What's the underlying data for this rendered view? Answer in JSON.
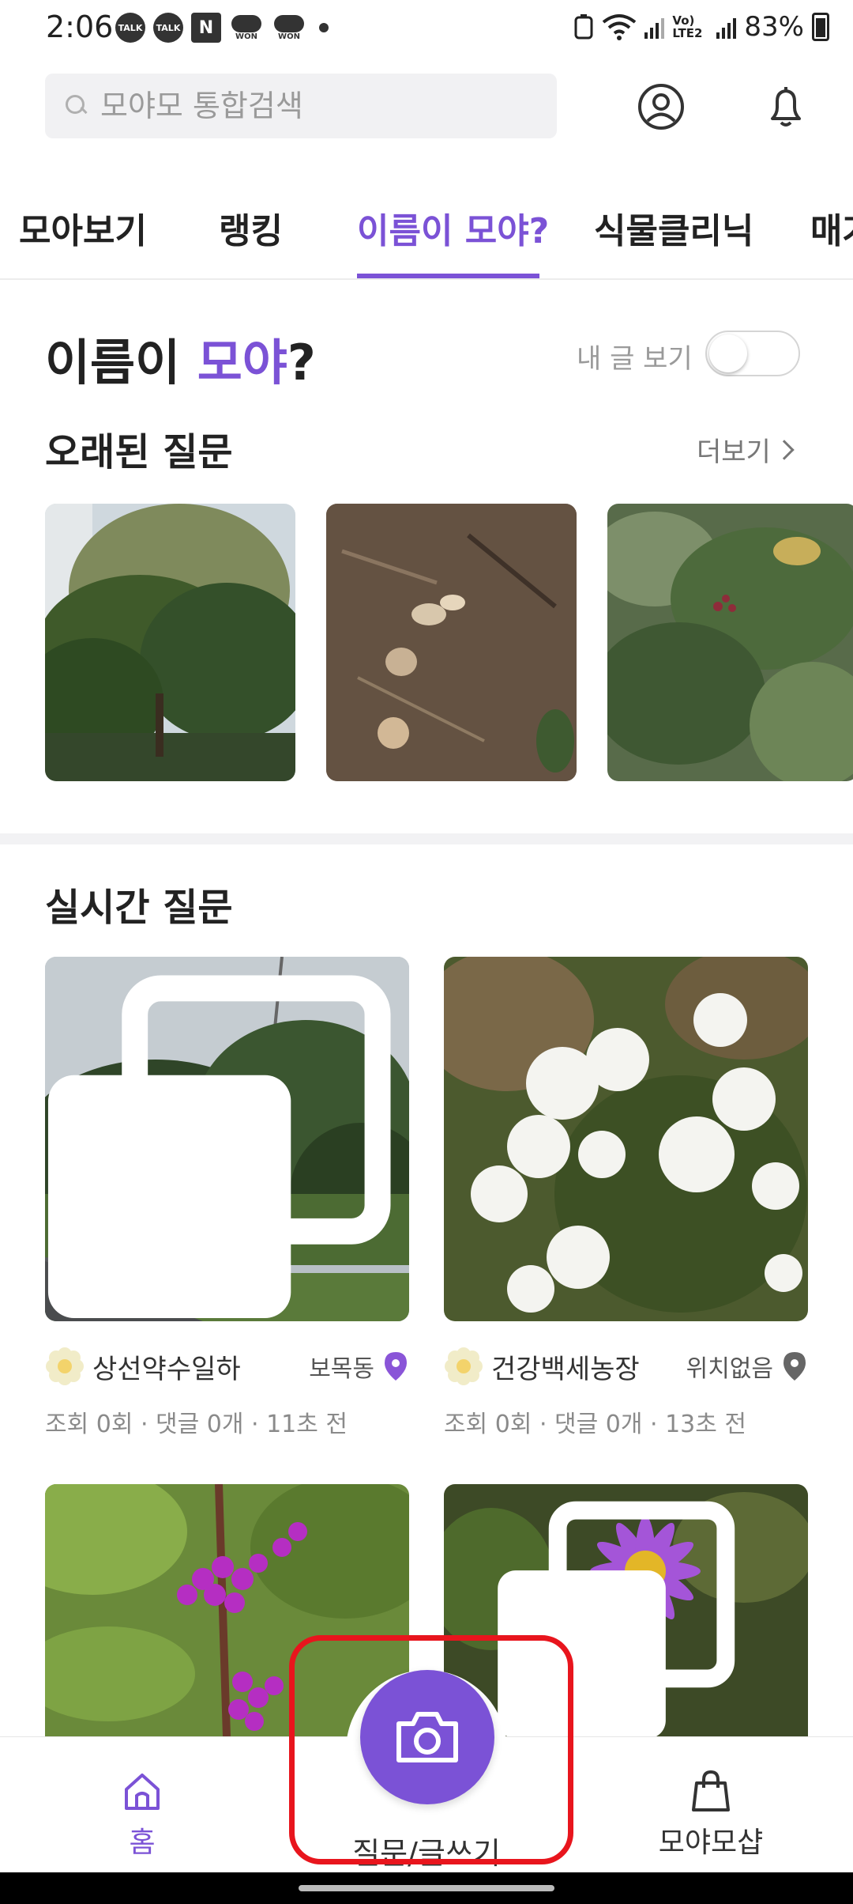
{
  "status_bar": {
    "time": "2:06",
    "notifications": [
      "TALK",
      "TALK",
      "N",
      "WON",
      "WON"
    ],
    "network": "Vo) LTE2",
    "battery": "83%"
  },
  "search": {
    "placeholder": "모야모 통합검색"
  },
  "tabs": [
    "모아보기",
    "랭킹",
    "이름이 모야?",
    "식물클리닉",
    "매거"
  ],
  "active_tab": "이름이 모야?",
  "page": {
    "title_prefix": "이름이 ",
    "title_accent": "모야",
    "title_suffix": "?",
    "my_posts_label": "내 글 보기",
    "my_posts_toggle_on": false
  },
  "old_questions": {
    "title": "오래된 질문",
    "more_label": "더보기"
  },
  "live_questions": {
    "title": "실시간 질문",
    "cards": [
      {
        "nickname": "상선약수일하",
        "location": "보목동",
        "stats": "조회 0회 · 댓글 0개 · 11초 전"
      },
      {
        "nickname": "건강백세농장",
        "location": "위치없음",
        "stats": "조회 0회 · 댓글 0개 · 13초 전"
      }
    ]
  },
  "bottom_nav": {
    "home": "홈",
    "write": "질문/글쓰기",
    "shop": "모야모샵"
  },
  "colors": {
    "accent": "#7b52d6",
    "highlight": "#e8151d"
  }
}
